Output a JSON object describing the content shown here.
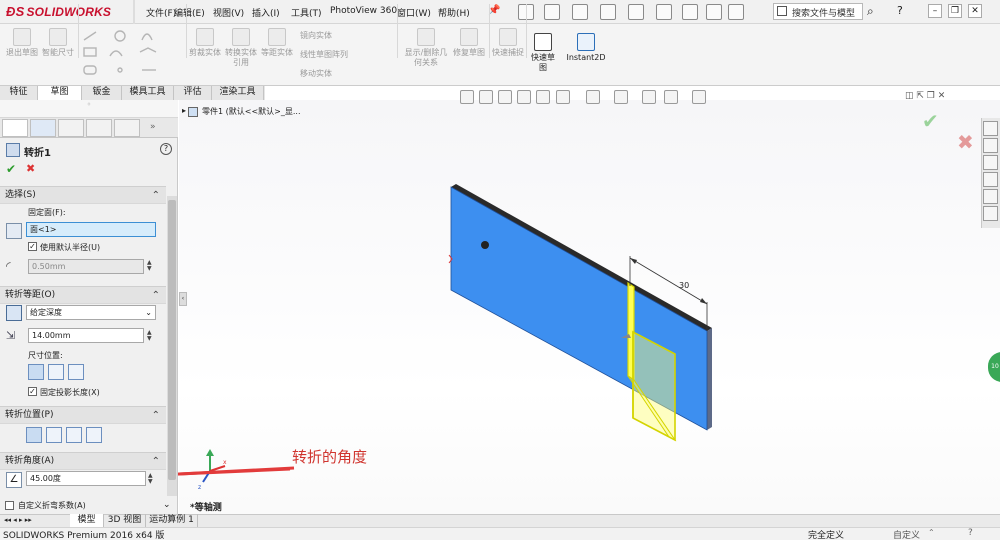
{
  "app": {
    "logo": "SOLIDWORKS",
    "menus": [
      "文件(F)",
      "编辑(E)",
      "视图(V)",
      "插入(I)",
      "工具(T)",
      "PhotoView 360",
      "窗口(W)",
      "帮助(H)"
    ],
    "search_placeholder": "搜索文件与模型"
  },
  "command_manager": {
    "buttons": [
      "退出草图",
      "智能尺寸",
      "剪裁实体",
      "转换实体引用",
      "等距实体",
      "镜向实体",
      "线性草图阵列",
      "移动实体",
      "显示/删除几何关系",
      "修复草图",
      "快速捕捉",
      "快速草图",
      "Instant2D"
    ]
  },
  "tabs": [
    "特征",
    "草图",
    "钣金",
    "模具工具",
    "评估",
    "渲染工具"
  ],
  "active_tab": "草图",
  "property_manager": {
    "title": "转折1",
    "ok_icon": "check-icon",
    "cancel_icon": "close-icon",
    "selection": {
      "header": "选择(S)",
      "fixed_face_label": "固定面(F):",
      "fixed_face_value": "面<1>",
      "use_default_radius": "使用默认半径(U)",
      "radius_value": "0.50mm"
    },
    "offset": {
      "header": "转折等距(O)",
      "end_condition": "给定深度",
      "distance": "14.00mm",
      "dim_position_label": "尺寸位置:",
      "fix_projected_length": "固定投影长度(X)"
    },
    "position": {
      "header": "转折位置(P)"
    },
    "angle": {
      "header": "转折角度(A)",
      "value": "45.00度"
    },
    "custom_bend": {
      "label": "自定义折弯系数(A)"
    }
  },
  "graphics": {
    "tree_label": "零件1  (默认<<默认>_显...",
    "annotation_text": "转折的角度",
    "dimension_value": "30",
    "view_label": "*等轴测",
    "part_color": "#3d8ff0",
    "highlight_color": "#ffff66"
  },
  "bottom_tabs": [
    "模型",
    "3D 视图",
    "运动算例 1"
  ],
  "status": {
    "product": "SOLIDWORKS Premium 2016 x64 版",
    "state": "完全定义",
    "custom": "自定义"
  }
}
